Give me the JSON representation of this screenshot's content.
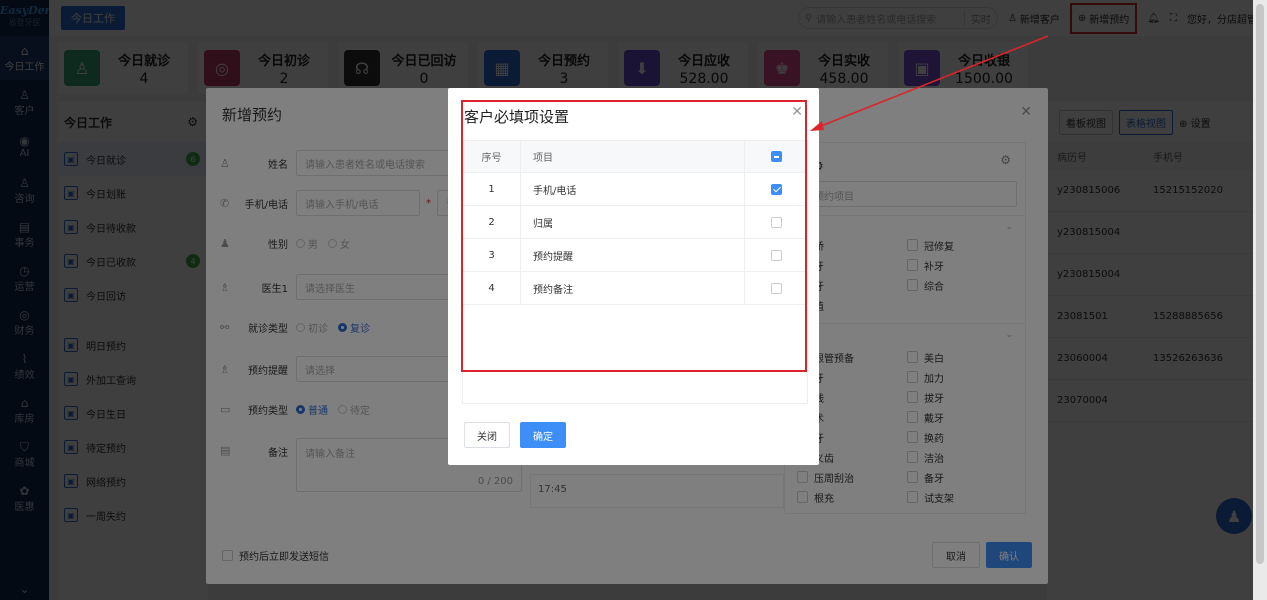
{
  "app": {
    "logo": "EasyDent",
    "logo_sub": "易登牙医"
  },
  "sidebar": {
    "items": [
      {
        "label": "今日工作",
        "icon": "home-icon",
        "glyph": "⌂"
      },
      {
        "label": "客户",
        "icon": "user-icon",
        "glyph": "♙"
      },
      {
        "label": "AI",
        "icon": "ai-icon",
        "glyph": "◉"
      },
      {
        "label": "咨询",
        "icon": "consult-icon",
        "glyph": "♙"
      },
      {
        "label": "事务",
        "icon": "task-icon",
        "glyph": "▤"
      },
      {
        "label": "运营",
        "icon": "clock-icon",
        "glyph": "◷"
      },
      {
        "label": "财务",
        "icon": "finance-icon",
        "glyph": "◎"
      },
      {
        "label": "绩效",
        "icon": "chart-icon",
        "glyph": "⌇"
      },
      {
        "label": "库房",
        "icon": "warehouse-icon",
        "glyph": "⌂"
      },
      {
        "label": "商城",
        "icon": "cart-icon",
        "glyph": "⛉"
      },
      {
        "label": "医惠",
        "icon": "medical-icon",
        "glyph": "✿"
      }
    ]
  },
  "topbar": {
    "tab": "今日工作",
    "search_placeholder": "请输入患者姓名或电话搜索",
    "search_mode": "实时",
    "new_customer": "新增客户",
    "new_appointment": "新增预约",
    "greeting": "您好，分店超管"
  },
  "stats": [
    {
      "label": "今日就诊",
      "value": "4",
      "color": "#3aaa7c",
      "glyph": "♙"
    },
    {
      "label": "今日初诊",
      "value": "2",
      "color": "#c23a6a",
      "glyph": "◎"
    },
    {
      "label": "今日已回访",
      "value": "0",
      "color": "#333333",
      "glyph": "☊"
    },
    {
      "label": "今日预约",
      "value": "3",
      "color": "#2f6fd6",
      "glyph": "▦"
    },
    {
      "label": "今日应收",
      "value": "528.00",
      "color": "#6b4fd6",
      "glyph": "⬇"
    },
    {
      "label": "今日实收",
      "value": "458.00",
      "color": "#e64b8c",
      "glyph": "♚"
    },
    {
      "label": "今日收银",
      "value": "1500.00",
      "color": "#7a52d6",
      "glyph": "▣"
    }
  ],
  "worklist": {
    "title": "今日工作",
    "items": [
      {
        "label": "今日就诊",
        "badge": "6",
        "active": true
      },
      {
        "label": "今日划账",
        "badge": ""
      },
      {
        "label": "今日待收款",
        "badge": ""
      },
      {
        "label": "今日已收款",
        "badge": "4"
      },
      {
        "label": "今日回访",
        "badge": ""
      },
      {
        "label": "明日预约",
        "badge": ""
      },
      {
        "label": "外加工查询",
        "badge": ""
      },
      {
        "label": "今日生日",
        "badge": ""
      },
      {
        "label": "待定预约",
        "badge": ""
      },
      {
        "label": "网络预约",
        "badge": ""
      },
      {
        "label": "一周失约",
        "badge": ""
      }
    ]
  },
  "right_table": {
    "btn_view1": "看板视图",
    "btn_view2": "表格视图",
    "settings": "设置",
    "col1": "病历号",
    "col2": "手机号",
    "rows": [
      [
        "y230815006",
        "15215152020"
      ],
      [
        "y230815004",
        ""
      ],
      [
        "y230815004",
        ""
      ],
      [
        "23081501",
        "15288885656"
      ],
      [
        "23060004",
        "13526263636"
      ],
      [
        "23070004",
        ""
      ]
    ]
  },
  "new_appt": {
    "title": "新增预约",
    "name_label": "姓名",
    "name_ph": "请输入患者姓名或电话搜索",
    "phone_label": "手机/电话",
    "phone_ph": "请输入手机/电话",
    "phone2_ph": "请",
    "gender_label": "性别",
    "male": "男",
    "female": "女",
    "doctor_label": "医生1",
    "doctor_ph": "请选择医生",
    "visit_type_label": "就诊类型",
    "first_visit": "初诊",
    "return_visit": "复诊",
    "reminder_label": "预约提醒",
    "reminder_ph": "请选择",
    "appt_type_label": "预约类型",
    "normal": "普通",
    "pending": "待定",
    "note_label": "备注",
    "note_ph": "请输入备注",
    "note_count": "0 / 200",
    "time": "17:45",
    "sms": "预约后立即发送短信",
    "cancel": "取消",
    "confirm": "确认",
    "proj_title": "目",
    "proj_search_ph": "索预约项目",
    "proj_group1": [
      [
        "矫",
        "冠修复"
      ],
      [
        "牙",
        "补牙"
      ],
      [
        "牙",
        "综合"
      ],
      [
        "植",
        ""
      ]
    ],
    "proj_group2_head": "类",
    "proj_group2": [
      [
        "根管预备",
        "美白"
      ],
      [
        "牙",
        "加力"
      ],
      [
        "线",
        "拔牙"
      ],
      [
        "术",
        "戴牙"
      ],
      [
        "牙",
        "换药"
      ],
      [
        "义齿",
        "洁治"
      ],
      [
        "压周刮治",
        "备牙"
      ],
      [
        "根充",
        "试支架"
      ]
    ]
  },
  "req_modal": {
    "title": "客户必填项设置",
    "col_seq": "序号",
    "col_item": "项目",
    "rows": [
      {
        "seq": "1",
        "item": "手机/电话",
        "checked": true
      },
      {
        "seq": "2",
        "item": "归属",
        "checked": false
      },
      {
        "seq": "3",
        "item": "预约提醒",
        "checked": false
      },
      {
        "seq": "4",
        "item": "预约备注",
        "checked": false
      }
    ],
    "close": "关闭",
    "ok": "确定"
  }
}
